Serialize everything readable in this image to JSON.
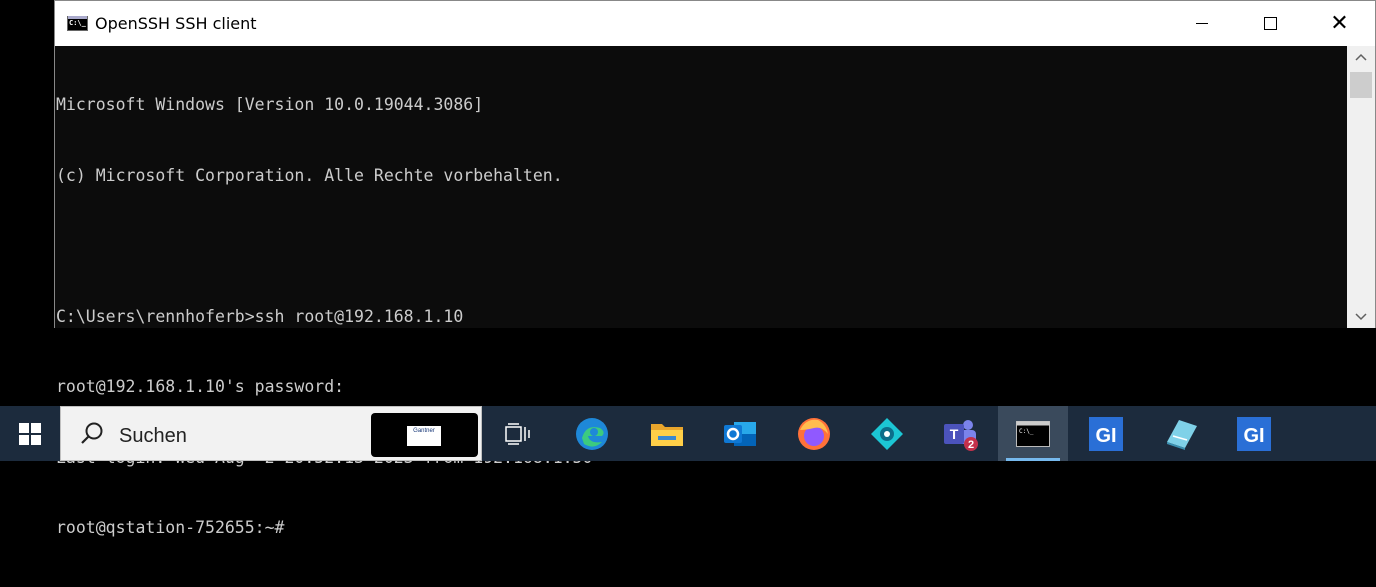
{
  "window": {
    "title": "OpenSSH SSH client",
    "icon": "console-app-icon",
    "icon_text": "C:\\_",
    "controls": {
      "minimize": "minimize-icon",
      "maximize": "maximize-icon",
      "close": "close-icon",
      "close_glyph": "✕"
    }
  },
  "console": {
    "lines": [
      "Microsoft Windows [Version 10.0.19044.3086]",
      "(c) Microsoft Corporation. Alle Rechte vorbehalten.",
      "",
      "C:\\Users\\rennhoferb>ssh root@192.168.1.10",
      "root@192.168.1.10's password:",
      "Last login: Wed Aug  2 20:52:13 2023 from 192.168.1.50",
      "root@qstation-752655:~#"
    ],
    "colors": {
      "background": "#0c0c0c",
      "text": "#cccccc"
    }
  },
  "taskbar": {
    "search_placeholder": "Suchen",
    "promo_logo_text": "Gantner",
    "apps": [
      {
        "name": "task-view-icon"
      },
      {
        "name": "edge-icon"
      },
      {
        "name": "file-explorer-icon"
      },
      {
        "name": "outlook-icon",
        "letter": "o"
      },
      {
        "name": "firefox-icon"
      },
      {
        "name": "dynamics-icon"
      },
      {
        "name": "teams-icon",
        "letter": "T",
        "badge": "2"
      },
      {
        "name": "terminal-icon",
        "active": true
      },
      {
        "name": "gi-app-icon",
        "letter": "GI"
      },
      {
        "name": "notepad-icon"
      },
      {
        "name": "gi-app-icon-2",
        "letter": "GI"
      }
    ],
    "colors": {
      "background": "#1c2b3d",
      "accent": "#76b9ed"
    }
  }
}
